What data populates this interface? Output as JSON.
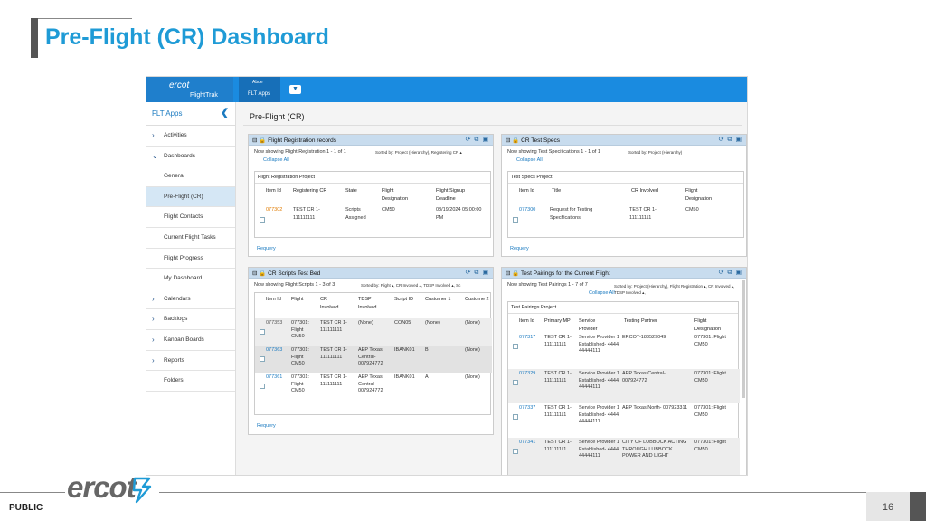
{
  "slide": {
    "title": "Pre-Flight (CR) Dashboard",
    "footer_label": "PUBLIC",
    "page_number": "16",
    "logo_text": "ercot"
  },
  "app": {
    "brand": "ercot",
    "brand_sub": "FlightTrak",
    "tab_top": "Abde",
    "tab_label": "FLT Apps"
  },
  "sidebar": {
    "header": "FLT Apps",
    "items": [
      {
        "label": "Activities",
        "icon": "chevron-right-icon",
        "active": false
      },
      {
        "label": "Dashboards",
        "icon": "chevron-down-icon",
        "active": false
      },
      {
        "label": "General",
        "icon": "",
        "active": false
      },
      {
        "label": "Pre-Flight (CR)",
        "icon": "",
        "active": true
      },
      {
        "label": "Flight Contacts",
        "icon": "",
        "active": false
      },
      {
        "label": "Current Flight Tasks",
        "icon": "",
        "active": false
      },
      {
        "label": "Flight Progress",
        "icon": "",
        "active": false
      },
      {
        "label": "My Dashboard",
        "icon": "",
        "active": false
      },
      {
        "label": "Calendars",
        "icon": "chevron-right-icon",
        "active": false
      },
      {
        "label": "Backlogs",
        "icon": "chevron-right-icon",
        "active": false
      },
      {
        "label": "Kanban Boards",
        "icon": "chevron-right-icon",
        "active": false
      },
      {
        "label": "Reports",
        "icon": "chevron-right-icon",
        "active": false
      },
      {
        "label": "Folders",
        "icon": "",
        "active": false
      }
    ]
  },
  "main": {
    "title": "Pre-Flight (CR)",
    "panels": {
      "registration": {
        "title": "Flight Registration records",
        "showing": "Now showing Flight Registration 1 - 1 of 1",
        "sorted": "Sorted by: Project (Hierarchy), Registering CR ▴",
        "collapse": "Collapse All",
        "project": "Flight Registration Project",
        "headers": [
          "Item Id",
          "Registering CR",
          "State",
          "Flight Designation",
          "Flight Signup Deadline"
        ],
        "rows": [
          {
            "id": "077302",
            "cr": "TEST CR 1- 111111111",
            "state": "Scripts Assigned",
            "designation": "CM50",
            "deadline": "08/19/2024 05:00:00 PM"
          }
        ],
        "requery": "Requery"
      },
      "testspecs": {
        "title": "CR Test Specs",
        "showing": "Now showing Test Specifications 1 - 1 of 1",
        "sorted": "Sorted by: Project (Hierarchy)",
        "collapse": "Collapse All",
        "project": "Test Specs Project",
        "headers": [
          "Item Id",
          "Title",
          "CR Involved",
          "Flight Designation"
        ],
        "rows": [
          {
            "id": "077300",
            "title": "Request for Testing Specifications",
            "cr": "TEST CR 1- 111111111",
            "designation": "CM50"
          }
        ],
        "requery": "Requery"
      },
      "scripts": {
        "title": "CR Scripts Test Bed",
        "showing": "Now showing Flight Scripts 1 - 3 of 3",
        "sorted": "Sorted by: Flight ▴, CR Involved ▴, TDSP Involved ▴, Sc",
        "headers": [
          "Item Id",
          "Flight",
          "CR Involved",
          "TDSP Involved",
          "Script ID",
          "Customer 1",
          "Custome 2"
        ],
        "rows": [
          {
            "id": "077353",
            "flight": "077301: Flight CM50",
            "cr": "TEST CR 1- 111111111",
            "tdsp": "(None)",
            "script": "CON05",
            "c1": "(None)",
            "c2": "(None)"
          },
          {
            "id": "077363",
            "flight": "077301: Flight CM50",
            "cr": "TEST CR 1- 111111111",
            "tdsp": "AEP Texas Central- 007924772",
            "script": "IBANK01",
            "c1": "B",
            "c2": "(None)"
          },
          {
            "id": "077361",
            "flight": "077301: Flight CM50",
            "cr": "TEST CR 1- 111111111",
            "tdsp": "AEP Texas Central- 007924772",
            "script": "IBANK01",
            "c1": "A",
            "c2": "(None)"
          }
        ],
        "requery": "Requery"
      },
      "pairings": {
        "title": "Test Pairings for the Current Flight",
        "showing": "Now showing Test Pairings 1 - 7 of 7",
        "sorted": "Sorted by: Project (Hierarchy), Flight Registration ▴, CR Involved ▴, TDSP Involved ▴,",
        "collapse": "Collapse All",
        "project": "Test Pairings Project",
        "headers": [
          "Item Id",
          "Primary MP",
          "Service Provider",
          "Testing Partner",
          "Flight Designation"
        ],
        "rows": [
          {
            "id": "077317",
            "mp": "TEST CR 1- 111111111",
            "sp": "Service Provider 1 Established- 444444444111",
            "tp": "ERCOT-183529049",
            "fd": "077301: Flight CM50"
          },
          {
            "id": "077329",
            "mp": "TEST CR 1- 111111111",
            "sp": "Service Provider 1 Established- 444444444111",
            "tp": "AEP Texas Central- 007924772",
            "fd": "077301: Flight CM50"
          },
          {
            "id": "077337",
            "mp": "TEST CR 1- 111111111",
            "sp": "Service Provider 1 Established- 444444444111",
            "tp": "AEP Texas North- 007923311",
            "fd": "077301: Flight CM50"
          },
          {
            "id": "077341",
            "mp": "TEST CR 1- 111111111",
            "sp": "Service Provider 1 Established- 444444444111",
            "tp": "CITY OF LUBBOCK ACTING THROUGH LUBBOCK POWER AND LIGHT",
            "fd": "077301: Flight CM50"
          }
        ]
      }
    }
  }
}
